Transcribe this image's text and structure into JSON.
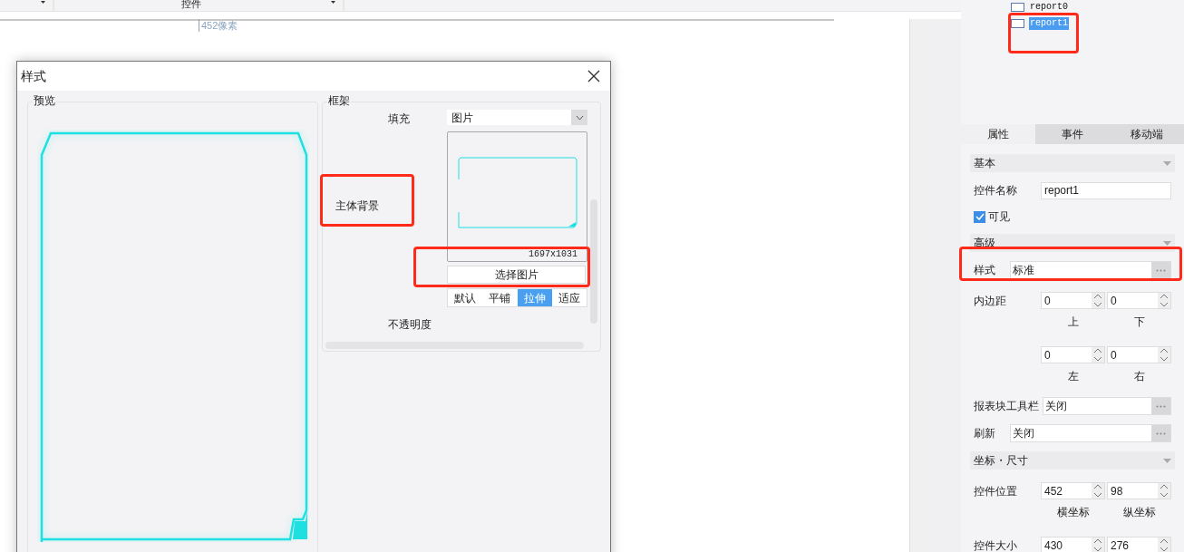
{
  "toolbar": {
    "label": "控件"
  },
  "canvas": {
    "ruler_label": "452像素"
  },
  "dialog": {
    "title": "样式",
    "preview": {
      "legend": "预览"
    },
    "frame": {
      "legend": "框架",
      "fill_label": "填充",
      "fill_value": "图片",
      "section_label": "主体背景",
      "image_size": "1697x1031",
      "choose_button": "选择图片",
      "modes": [
        {
          "label": "默认",
          "selected": false
        },
        {
          "label": "平铺",
          "selected": false
        },
        {
          "label": "拉伸",
          "selected": true
        },
        {
          "label": "适应",
          "selected": false
        }
      ],
      "opacity_label": "不透明度"
    }
  },
  "right_panel": {
    "tree": [
      {
        "label": "report0",
        "selected": false
      },
      {
        "label": "report1",
        "selected": true
      }
    ],
    "tabs": [
      {
        "label": "属性",
        "selected": true
      },
      {
        "label": "事件",
        "selected": false
      },
      {
        "label": "移动端",
        "selected": false
      }
    ],
    "properties": [
      {
        "kind": "section",
        "label": "基本"
      },
      {
        "kind": "text",
        "label": "控件名称",
        "value": "report1"
      },
      {
        "kind": "checkbox",
        "label": "可见",
        "checked": true
      },
      {
        "kind": "section",
        "label": "高级"
      },
      {
        "kind": "picker",
        "label": "样式",
        "value": "标准"
      },
      {
        "kind": "spins",
        "label": "内边距",
        "fields": [
          {
            "value": "0",
            "caption": "上"
          },
          {
            "value": "0",
            "caption": "下"
          }
        ]
      },
      {
        "kind": "spins",
        "fields": [
          {
            "value": "0",
            "caption": "左"
          },
          {
            "value": "0",
            "caption": "右"
          }
        ]
      },
      {
        "kind": "picker",
        "label": "报表块工具栏",
        "value": "关闭"
      },
      {
        "kind": "picker",
        "label": "刷新",
        "value": "关闭"
      },
      {
        "kind": "section",
        "label": "坐标・尺寸"
      },
      {
        "kind": "spins",
        "label": "控件位置",
        "fields": [
          {
            "value": "452",
            "caption": "横坐标"
          },
          {
            "value": "98",
            "caption": "纵坐标"
          }
        ]
      },
      {
        "kind": "spins",
        "label": "控件大小",
        "fields": [
          {
            "value": "430"
          },
          {
            "value": "276"
          }
        ]
      }
    ]
  },
  "annotations": [
    {
      "kind": "box"
    },
    {
      "kind": "box"
    },
    {
      "kind": "box"
    },
    {
      "kind": "box"
    }
  ]
}
